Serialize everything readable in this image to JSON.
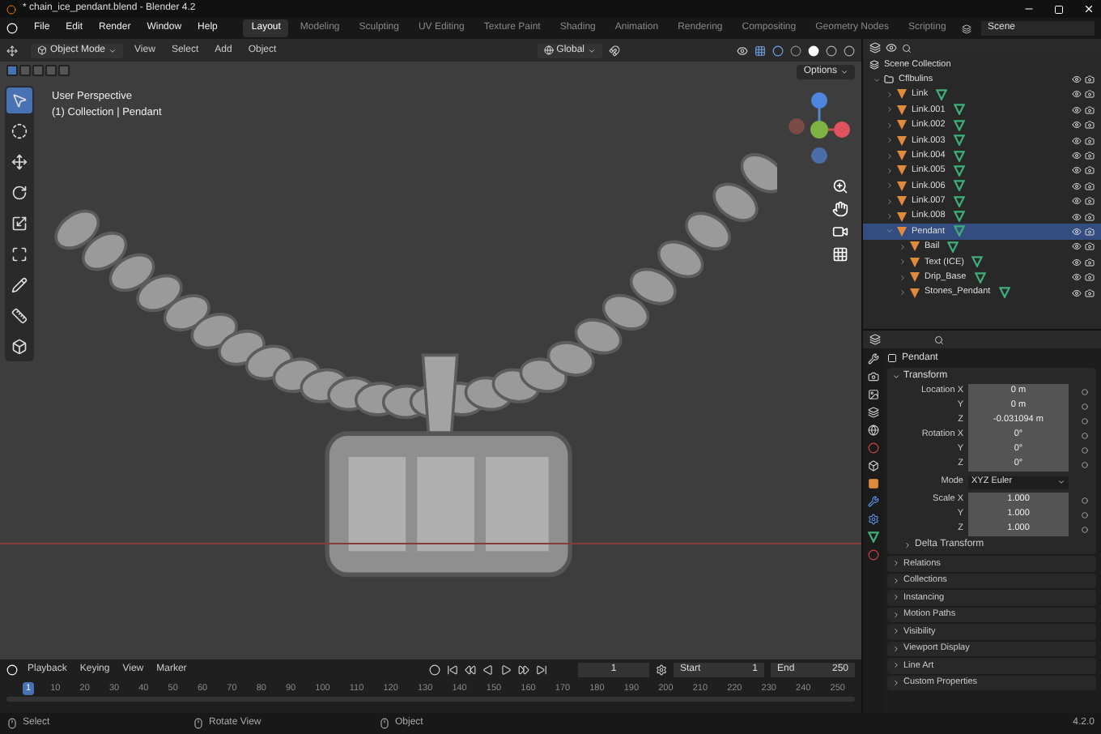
{
  "window": {
    "title": "* chain_ice_pendant.blend - Blender 4.2"
  },
  "menu": [
    "File",
    "Edit",
    "Render",
    "Window",
    "Help"
  ],
  "workspaces": [
    {
      "label": "Layout",
      "selected": true
    },
    {
      "label": "Modeling",
      "selected": false
    },
    {
      "label": "Sculpting",
      "selected": false
    },
    {
      "label": "UV Editing",
      "selected": false
    },
    {
      "label": "Texture Paint",
      "selected": false
    },
    {
      "label": "Shading",
      "selected": false
    },
    {
      "label": "Animation",
      "selected": false
    },
    {
      "label": "Rendering",
      "selected": false
    },
    {
      "label": "Compositing",
      "selected": false
    },
    {
      "label": "Geometry Nodes",
      "selected": false
    },
    {
      "label": "Scripting",
      "selected": false
    }
  ],
  "scene": "Scene",
  "viewport_header": {
    "mode": "Object Mode",
    "menus": [
      "View",
      "Select",
      "Add",
      "Object"
    ],
    "orientation": "Global"
  },
  "select_modes": [
    {
      "selected": true
    },
    {
      "selected": false
    },
    {
      "selected": false
    },
    {
      "selected": false
    },
    {
      "selected": false
    }
  ],
  "viewport": {
    "view_name": "User Perspective",
    "context": "(1) Collection | Pendant",
    "options": "Options"
  },
  "tools": [
    {
      "kind": "select",
      "selected": true
    },
    {
      "kind": "cursor",
      "selected": false
    },
    {
      "kind": "move",
      "selected": false
    },
    {
      "kind": "rotate",
      "selected": false
    },
    {
      "kind": "scale",
      "selected": false
    },
    {
      "kind": "transform",
      "selected": false
    },
    {
      "kind": "annotate",
      "selected": false
    },
    {
      "kind": "measure",
      "selected": false
    },
    {
      "kind": "add",
      "selected": false
    }
  ],
  "outliner": {
    "root": "Scene Collection",
    "items": [
      {
        "name": "Cflbulins",
        "kind": "collection",
        "selected": false,
        "expanded": true,
        "children": [
          {
            "name": "Link",
            "kind": "object",
            "selected": false,
            "expanded": false
          },
          {
            "name": "Link.001",
            "kind": "object",
            "selected": false,
            "expanded": false
          },
          {
            "name": "Link.002",
            "kind": "object",
            "selected": false,
            "expanded": false
          },
          {
            "name": "Link.003",
            "kind": "object",
            "selected": false,
            "expanded": false
          },
          {
            "name": "Link.004",
            "kind": "object",
            "selected": false,
            "expanded": false
          },
          {
            "name": "Link.005",
            "kind": "object",
            "selected": false,
            "expanded": false
          },
          {
            "name": "Link.006",
            "kind": "object",
            "selected": false,
            "expanded": false
          },
          {
            "name": "Link.007",
            "kind": "object",
            "selected": false,
            "expanded": false
          },
          {
            "name": "Link.008",
            "kind": "object",
            "selected": false,
            "expanded": false
          },
          {
            "name": "Pendant",
            "kind": "object",
            "selected": true,
            "expanded": true,
            "children": [
              {
                "name": "Bail",
                "kind": "object",
                "selected": false,
                "expanded": false
              },
              {
                "name": "Text (ICE)",
                "kind": "object",
                "selected": false,
                "expanded": false
              },
              {
                "name": "Drip_Base",
                "kind": "object",
                "selected": false,
                "expanded": false
              },
              {
                "name": "Stones_Pendant",
                "kind": "object",
                "selected": false,
                "expanded": false
              }
            ]
          }
        ]
      }
    ]
  },
  "properties": {
    "object": "Pendant",
    "transform": {
      "title": "Transform",
      "expanded": true,
      "rows": [
        {
          "kind": "field",
          "label": "Location X",
          "value": "0 m"
        },
        {
          "kind": "field",
          "label": "Y",
          "value": "0 m"
        },
        {
          "kind": "field",
          "label": "Z",
          "value": "-0.031094 m"
        },
        {
          "kind": "field",
          "label": "Rotation X",
          "value": "0°"
        },
        {
          "kind": "field",
          "label": "Y",
          "value": "0°"
        },
        {
          "kind": "field",
          "label": "Z",
          "value": "0°"
        },
        {
          "kind": "dropdown",
          "label": "Mode",
          "value": "XYZ Euler"
        },
        {
          "kind": "field",
          "label": "Scale X",
          "value": "1.000"
        },
        {
          "kind": "field",
          "label": "Y",
          "value": "1.000"
        },
        {
          "kind": "field",
          "label": "Z",
          "value": "1.000"
        }
      ],
      "subpanels": [
        {
          "title": "Delta Transform",
          "expanded": false
        }
      ]
    },
    "panels": [
      {
        "title": "Relations",
        "expanded": false
      },
      {
        "title": "Collections",
        "expanded": false
      },
      {
        "title": "Instancing",
        "expanded": false
      },
      {
        "title": "Motion Paths",
        "expanded": false
      },
      {
        "title": "Visibility",
        "expanded": false
      },
      {
        "title": "Viewport Display",
        "expanded": false
      },
      {
        "title": "Line Art",
        "expanded": false
      },
      {
        "title": "Custom Properties",
        "expanded": false
      }
    ]
  },
  "timeline": {
    "menus": [
      "Playback",
      "Keying",
      "View",
      "Marker"
    ],
    "current_frame": "1",
    "start_label": "Start",
    "start": "1",
    "end_label": "End",
    "end": "250",
    "ruler": [
      {
        "label": "1",
        "selected": true
      },
      {
        "label": "10",
        "selected": false
      },
      {
        "label": "20",
        "selected": false
      },
      {
        "label": "30",
        "selected": false
      },
      {
        "label": "40",
        "selected": false
      },
      {
        "label": "50",
        "selected": false
      },
      {
        "label": "60",
        "selected": false
      },
      {
        "label": "70",
        "selected": false
      },
      {
        "label": "80",
        "selected": false
      },
      {
        "label": "90",
        "selected": false
      },
      {
        "label": "100",
        "selected": false
      },
      {
        "label": "110",
        "selected": false
      },
      {
        "label": "120",
        "selected": false
      },
      {
        "label": "130",
        "selected": false
      },
      {
        "label": "140",
        "selected": false
      },
      {
        "label": "150",
        "selected": false
      },
      {
        "label": "160",
        "selected": false
      },
      {
        "label": "170",
        "selected": false
      },
      {
        "label": "180",
        "selected": false
      },
      {
        "label": "190",
        "selected": false
      },
      {
        "label": "200",
        "selected": false
      },
      {
        "label": "210",
        "selected": false
      },
      {
        "label": "220",
        "selected": false
      },
      {
        "label": "230",
        "selected": false
      },
      {
        "label": "240",
        "selected": false
      },
      {
        "label": "250",
        "selected": false
      }
    ]
  },
  "status_bar": {
    "hints": [
      "Select",
      "Rotate View",
      "Object"
    ],
    "version": "4.2.0"
  }
}
